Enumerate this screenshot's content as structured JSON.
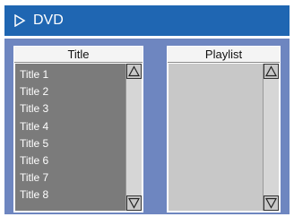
{
  "header": {
    "title": "DVD",
    "icon": "play-outline-icon"
  },
  "title_list": {
    "heading": "Title",
    "items": [
      "Title 1",
      "Title 2",
      "Title 3",
      "Title 4",
      "Title 5",
      "Title 6",
      "Title 7",
      "Title 8"
    ]
  },
  "playlist": {
    "heading": "Playlist",
    "items": []
  },
  "colors": {
    "header_bg": "#1f66b2",
    "panel_bg": "#6e86c0",
    "title_list_bg": "#7b7b7b",
    "playlist_bg": "#c8c8c8"
  }
}
